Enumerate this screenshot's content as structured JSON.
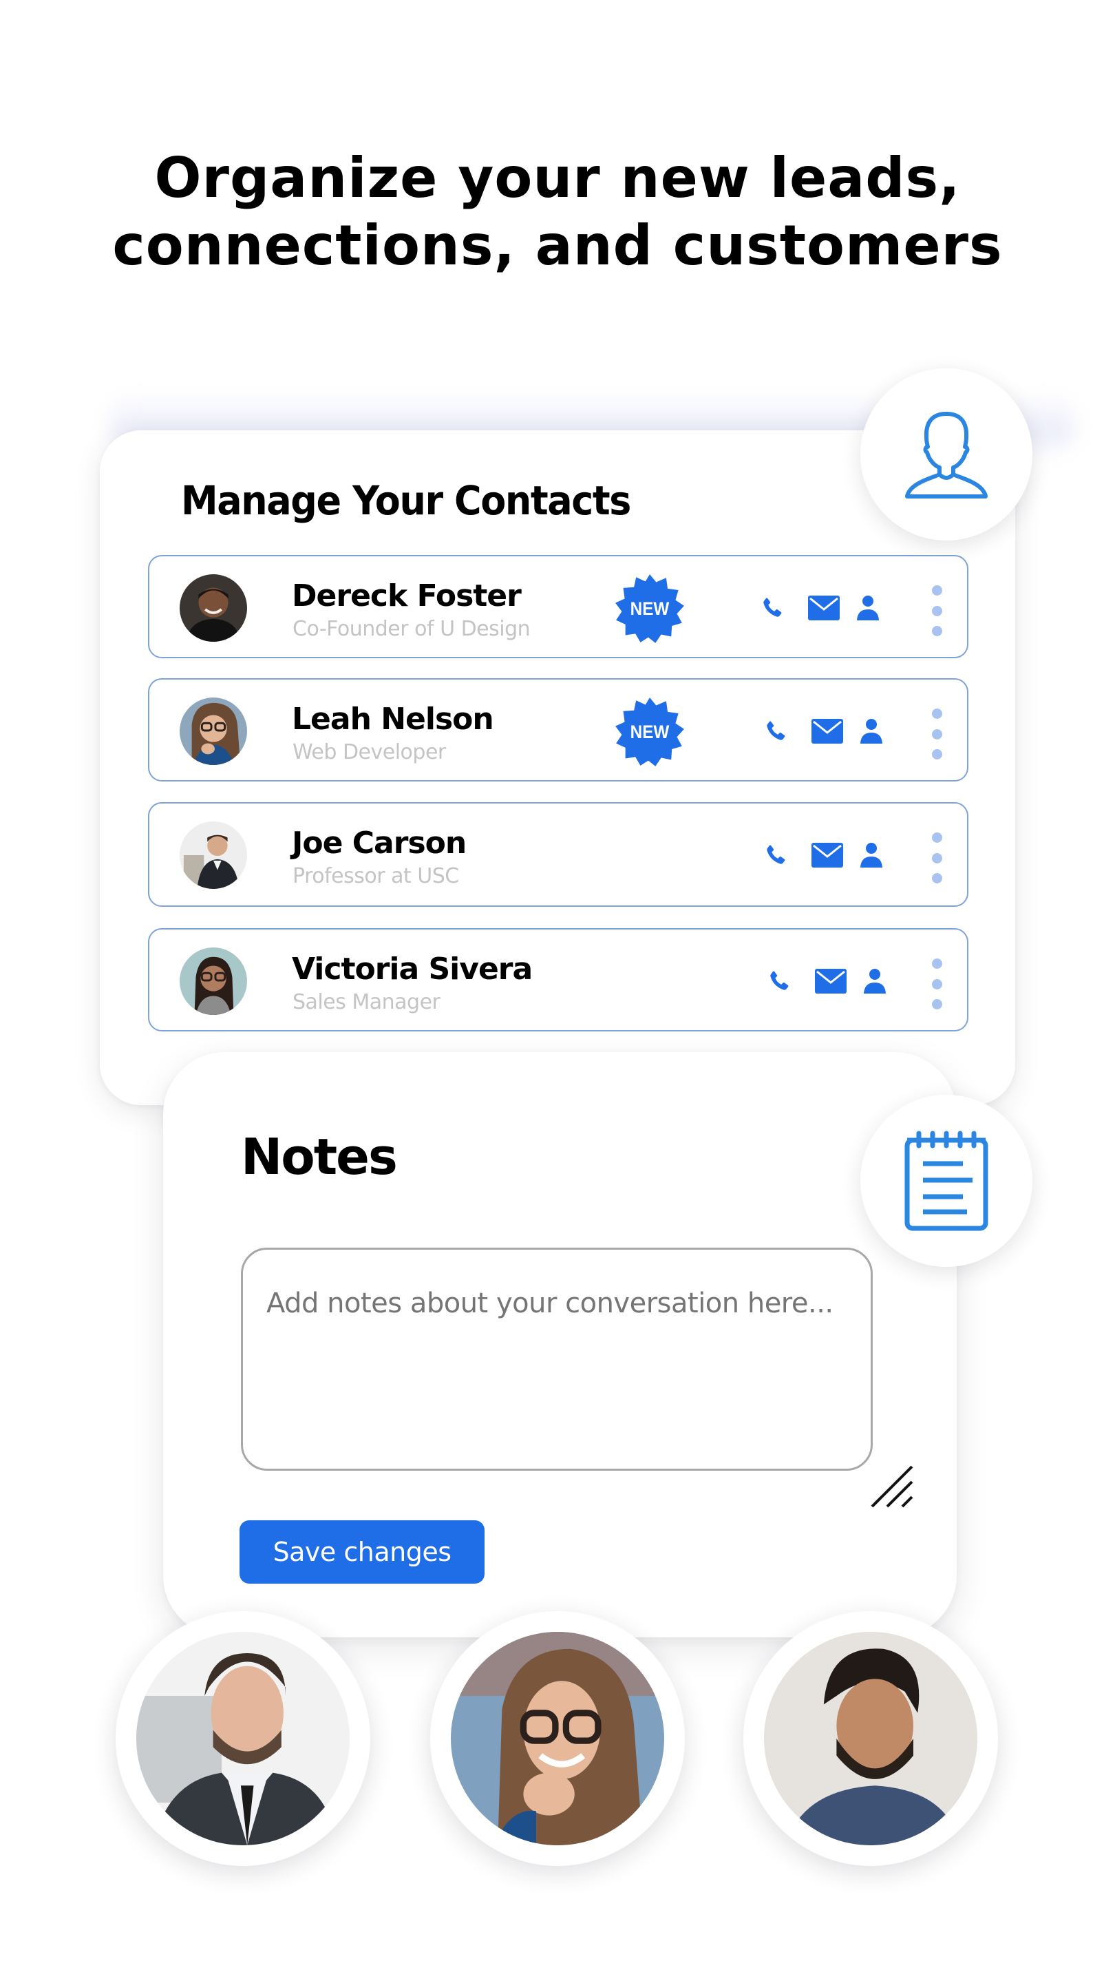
{
  "headline": {
    "line1": "Organize your new leads,",
    "line2": "connections, and customers"
  },
  "contacts_card": {
    "title": "Manage Your Contacts",
    "header_icon": "user-outline-icon",
    "contacts": [
      {
        "name": "Dereck Foster",
        "subtitle": "Co-Founder of U Design",
        "is_new": true,
        "badge_label": "NEW"
      },
      {
        "name": "Leah Nelson",
        "subtitle": "Web Developer",
        "is_new": true,
        "badge_label": "NEW"
      },
      {
        "name": "Joe Carson",
        "subtitle": "Professor at USC",
        "is_new": false,
        "badge_label": ""
      },
      {
        "name": "Victoria Sivera",
        "subtitle": "Sales Manager",
        "is_new": false,
        "badge_label": ""
      }
    ],
    "row_actions": [
      "phone-icon",
      "mail-icon",
      "user-icon",
      "more-vertical-icon"
    ]
  },
  "notes_card": {
    "title": "Notes",
    "header_icon": "notepad-icon",
    "textarea_placeholder": "Add notes about your conversation here...",
    "textarea_value": "",
    "save_label": "Save changes"
  },
  "bottom_avatars": [
    {
      "label": "man-in-suit-avatar"
    },
    {
      "label": "woman-with-glasses-avatar"
    },
    {
      "label": "bearded-man-avatar"
    }
  ],
  "colors": {
    "accent": "#1f6ee8",
    "row_border": "#7ea3dc",
    "icon_outline": "#2a86e0",
    "dots": "#a9c3f0",
    "subtitle": "#c4c4c4"
  }
}
